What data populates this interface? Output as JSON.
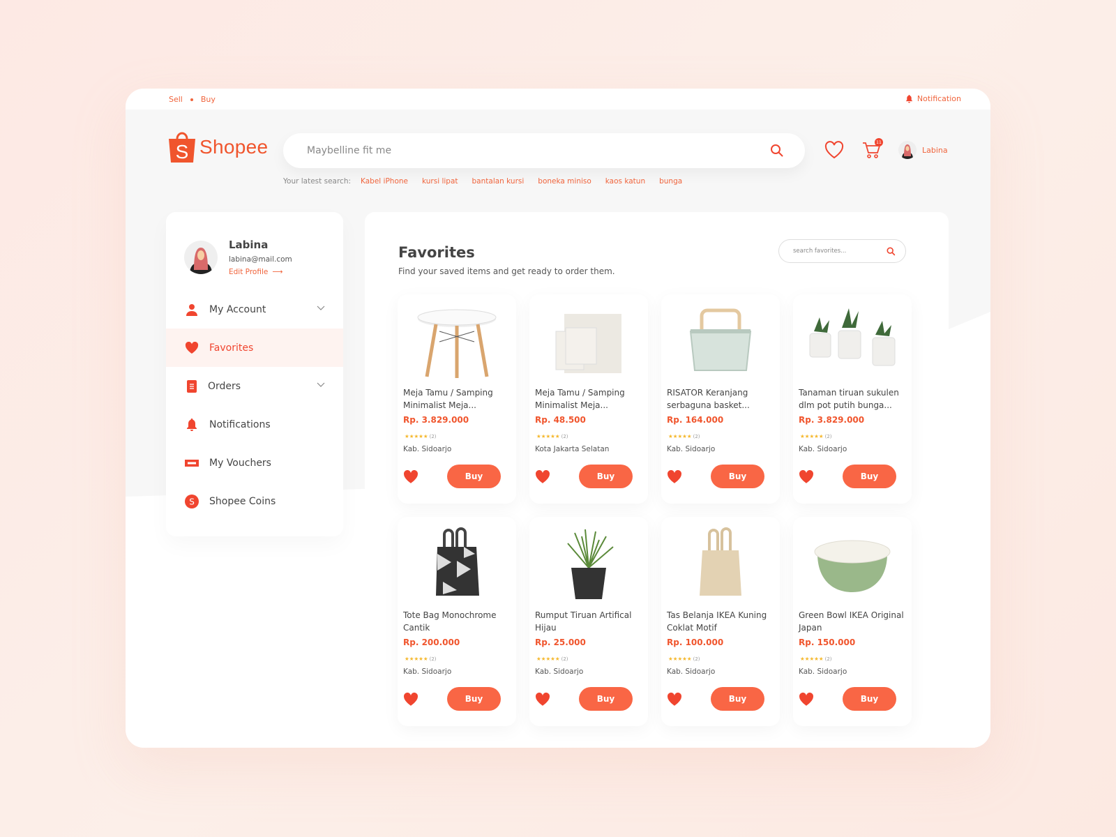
{
  "topbar": {
    "links": [
      "Sell",
      "Buy"
    ],
    "notification_label": "Notification"
  },
  "brand": {
    "name": "Shopee",
    "accent": "#f0552d"
  },
  "search": {
    "value": "",
    "placeholder": "Maybelline fit me",
    "latest_label": "Your latest search:",
    "latest": [
      "Kabel iPhone",
      "kursi lipat",
      "bantalan kursi",
      "boneka miniso",
      "kaos katun",
      "bunga"
    ]
  },
  "header": {
    "cart_count": "11",
    "user_name": "Labina"
  },
  "profile": {
    "name": "Labina",
    "email": "labina@mail.com",
    "edit_label": "Edit Profile"
  },
  "menu": [
    {
      "label": "My Account",
      "icon": "user-icon",
      "expandable": true
    },
    {
      "label": "Favorites",
      "icon": "heart-icon",
      "active": true
    },
    {
      "label": "Orders",
      "icon": "document-icon",
      "expandable": true
    },
    {
      "label": "Notifications",
      "icon": "bell-icon"
    },
    {
      "label": "My Vouchers",
      "icon": "voucher-icon"
    },
    {
      "label": "Shopee Coins",
      "icon": "coin-icon"
    }
  ],
  "favorites": {
    "title": "Favorites",
    "subtitle": "Find your saved items and get ready to order them.",
    "search_placeholder": "search favorites...",
    "buy_label": "Buy",
    "items": [
      {
        "title": "Meja Tamu / Samping Minimalist Meja...",
        "price": "Rp. 3.829.000",
        "rating_count": "(2)",
        "location": "Kab. Sidoarjo",
        "image": "round-table"
      },
      {
        "title": "Meja Tamu / Samping Minimalist Meja...",
        "price": "Rp. 48.500",
        "rating_count": "(2)",
        "location": "Kota Jakarta Selatan",
        "image": "towels"
      },
      {
        "title": "RISATOR Keranjang serbaguna basket...",
        "price": "Rp. 164.000",
        "rating_count": "(2)",
        "location": "Kab. Sidoarjo",
        "image": "basket"
      },
      {
        "title": "Tanaman tiruan sukulen dlm pot putih bunga...",
        "price": "Rp. 3.829.000",
        "rating_count": "(2)",
        "location": "Kab. Sidoarjo",
        "image": "succulents"
      },
      {
        "title": "Tote Bag Monochrome Cantik",
        "price": "Rp. 200.000",
        "rating_count": "(2)",
        "location": "Kab. Sidoarjo",
        "image": "tote-bag"
      },
      {
        "title": "Rumput Tiruan Artifical Hijau",
        "price": "Rp. 25.000",
        "rating_count": "(2)",
        "location": "Kab. Sidoarjo",
        "image": "grass-pot"
      },
      {
        "title": "Tas Belanja IKEA Kuning Coklat Motif",
        "price": "Rp. 100.000",
        "rating_count": "(2)",
        "location": "Kab. Sidoarjo",
        "image": "shopping-bag"
      },
      {
        "title": "Green Bowl IKEA Original Japan",
        "price": "Rp. 150.000",
        "rating_count": "(2)",
        "location": "Kab. Sidoarjo",
        "image": "green-bowl"
      }
    ]
  }
}
